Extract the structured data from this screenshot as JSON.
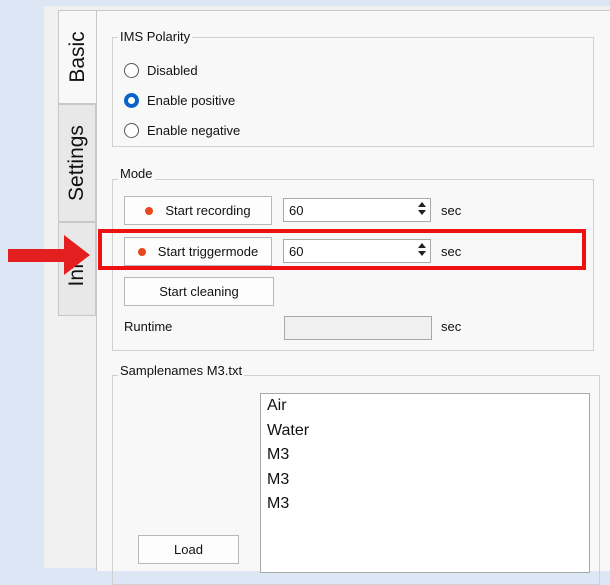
{
  "tabs": [
    "Basic",
    "Settings",
    "Info"
  ],
  "ims_polarity": {
    "title": "IMS Polarity",
    "options": [
      "Disabled",
      "Enable positive",
      "Enable negative"
    ],
    "selected": "Enable positive"
  },
  "mode": {
    "title": "Mode",
    "start_recording": {
      "label": "Start recording",
      "value": "60",
      "unit": "sec"
    },
    "start_triggermode": {
      "label": "Start triggermode",
      "value": "60",
      "unit": "sec"
    },
    "start_cleaning": {
      "label": "Start cleaning"
    },
    "runtime": {
      "label": "Runtime",
      "value": "",
      "unit": "sec"
    }
  },
  "samplenames": {
    "title": "Samplenames M3.txt",
    "load_label": "Load",
    "items": [
      "Air",
      "Water",
      "M3",
      "M3",
      "M3"
    ]
  },
  "colors": {
    "accent": "#0a63c9",
    "record_dot": "#e8481d",
    "annotation": "#e41f1f"
  }
}
